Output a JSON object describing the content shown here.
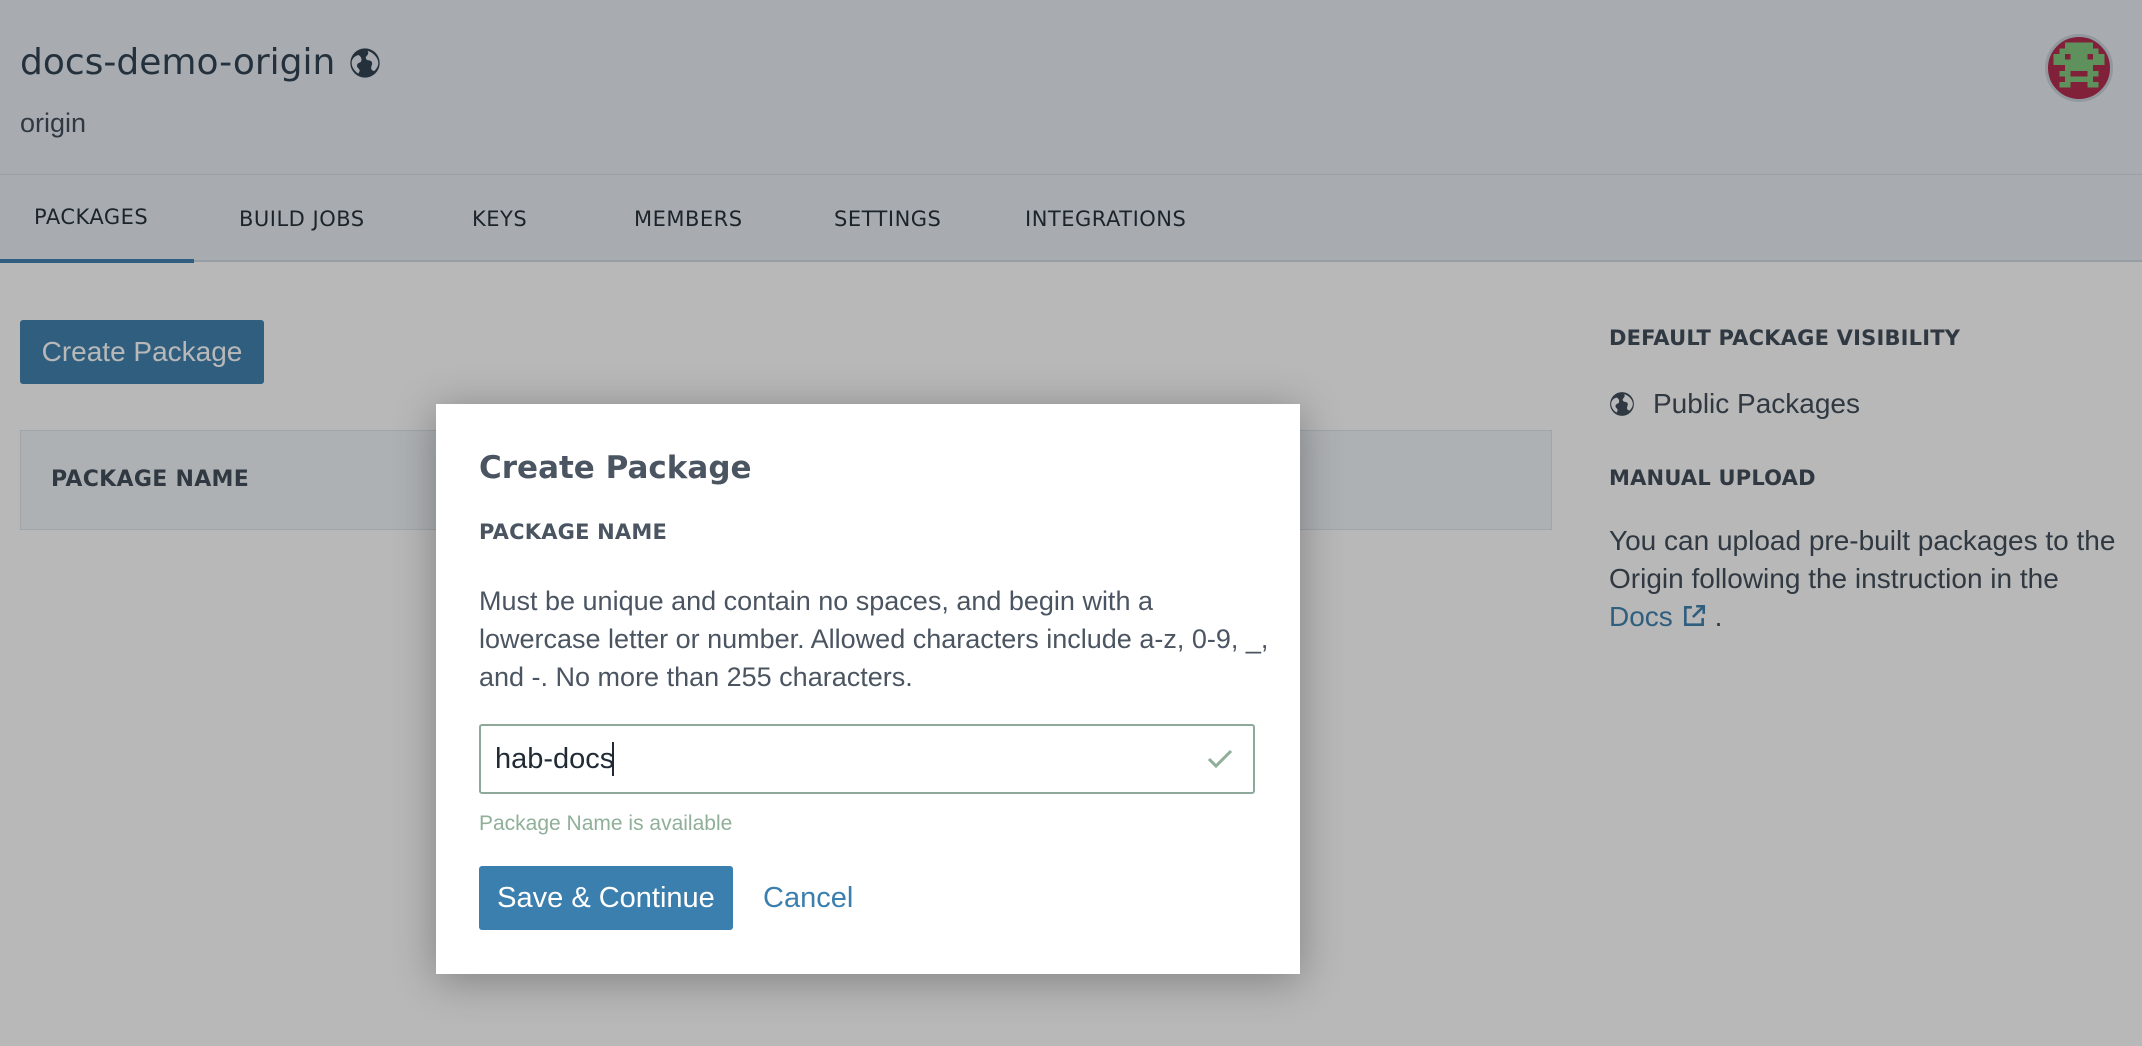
{
  "header": {
    "origin_name": "docs-demo-origin",
    "origin_subtitle": "origin",
    "visibility_icon": "globe-icon",
    "avatar_icon": "space-invader-avatar"
  },
  "tabs": [
    {
      "label": "PACKAGES",
      "active": true
    },
    {
      "label": "BUILD JOBS"
    },
    {
      "label": "KEYS"
    },
    {
      "label": "MEMBERS"
    },
    {
      "label": "SETTINGS"
    },
    {
      "label": "INTEGRATIONS"
    }
  ],
  "main": {
    "create_button_label": "Create Package",
    "table_header": "PACKAGE NAME"
  },
  "sidebar": {
    "visibility_heading": "DEFAULT PACKAGE VISIBILITY",
    "visibility_value": "Public Packages",
    "upload_heading": "MANUAL UPLOAD",
    "upload_text": "You can upload pre-built packages to the Origin following the instruction in the",
    "docs_link": "Docs",
    "upload_text_end": "."
  },
  "modal": {
    "title": "Create Package",
    "field_label": "PACKAGE NAME",
    "help_text": "Must be unique and contain no spaces, and begin with a lowercase letter or number. Allowed characters include a-z, 0-9, _, and -. No more than 255 characters.",
    "input_value": "hab-docs",
    "validation_message": "Package Name is available",
    "save_label": "Save & Continue",
    "cancel_label": "Cancel"
  },
  "colors": {
    "accent": "#3b7fae",
    "success": "#8faf99",
    "header_bg": "#e8eef4"
  }
}
